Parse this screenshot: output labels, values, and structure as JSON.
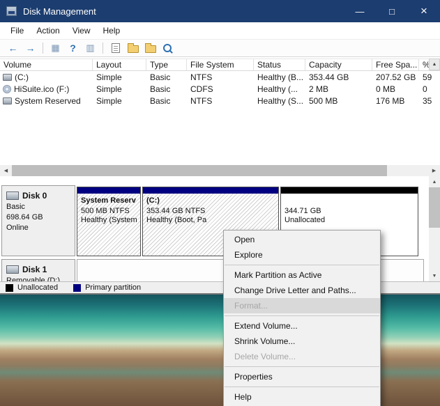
{
  "window": {
    "title": "Disk Management",
    "min_glyph": "—",
    "max_glyph": "□",
    "close_glyph": "×"
  },
  "menubar": {
    "items": [
      "File",
      "Action",
      "View",
      "Help"
    ]
  },
  "toolbar": {
    "back_glyph": "←",
    "forward_glyph": "→",
    "tree_glyph": "▦",
    "help_glyph": "?",
    "pane_glyph": "▥",
    "icon_names": [
      "back",
      "forward",
      "show-console-tree",
      "help",
      "show-action-pane",
      "export-list",
      "parent-folder",
      "folders",
      "search"
    ]
  },
  "glyphs": {
    "scroll_up": "▲",
    "scroll_down": "▼",
    "scroll_left": "◀",
    "scroll_right": "▶"
  },
  "volumes": {
    "columns": [
      "Volume",
      "Layout",
      "Type",
      "File System",
      "Status",
      "Capacity",
      "Free Spa...",
      "% F..."
    ],
    "rows": [
      {
        "icon": "drive",
        "volume": "(C:)",
        "layout": "Simple",
        "type": "Basic",
        "fs": "NTFS",
        "status": "Healthy (B...",
        "capacity": "353.44 GB",
        "free": "207.52 GB",
        "pct": "59"
      },
      {
        "icon": "cd",
        "volume": "HiSuite.ico (F:)",
        "layout": "Simple",
        "type": "Basic",
        "fs": "CDFS",
        "status": "Healthy (...",
        "capacity": "2 MB",
        "free": "0 MB",
        "pct": "0"
      },
      {
        "icon": "drive",
        "volume": "System Reserved",
        "layout": "Simple",
        "type": "Basic",
        "fs": "NTFS",
        "status": "Healthy (S...",
        "capacity": "500 MB",
        "free": "176 MB",
        "pct": "35"
      }
    ]
  },
  "disks": {
    "disk0": {
      "name": "Disk 0",
      "kind": "Basic",
      "size": "698.64 GB",
      "status": "Online",
      "partitions": [
        {
          "title": "System Reserv",
          "line2": "500 MB NTFS",
          "line3": "Healthy (System"
        },
        {
          "title": "(C:)",
          "line2": "353.44 GB NTFS",
          "line3": "Healthy (Boot, Pa"
        },
        {
          "title": "",
          "line2": "344.71 GB",
          "line3": "Unallocated"
        }
      ]
    },
    "disk1": {
      "name": "Disk 1",
      "kind": "Removable (D:)"
    }
  },
  "legend": {
    "items": [
      {
        "label": "Unallocated",
        "color": "#000000"
      },
      {
        "label": "Primary partition",
        "color": "#000080"
      }
    ]
  },
  "context_menu": {
    "items": [
      {
        "label": "Open"
      },
      {
        "label": "Explore"
      },
      {
        "separator": true
      },
      {
        "label": "Mark Partition as Active"
      },
      {
        "label": "Change Drive Letter and Paths..."
      },
      {
        "label": "Format...",
        "disabled": true,
        "highlighted": true
      },
      {
        "separator": true
      },
      {
        "label": "Extend Volume..."
      },
      {
        "label": "Shrink Volume..."
      },
      {
        "label": "Delete Volume...",
        "disabled": true
      },
      {
        "separator": true
      },
      {
        "label": "Properties"
      },
      {
        "separator": true
      },
      {
        "label": "Help"
      }
    ]
  },
  "colors": {
    "titlebar": "#1c3d6f",
    "primary_partition": "#000080",
    "unallocated": "#000000"
  }
}
